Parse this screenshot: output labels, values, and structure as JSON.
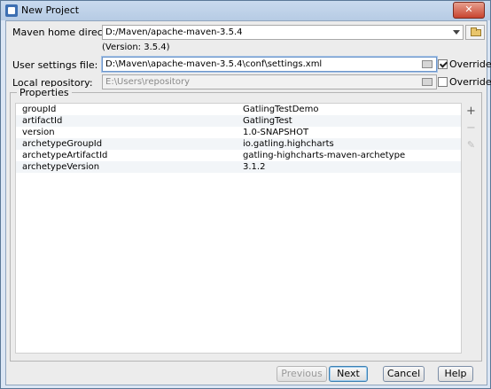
{
  "window": {
    "title": "New Project",
    "close_glyph": "✕"
  },
  "maven_home": {
    "label": "Maven home directory:",
    "value": "D:/Maven/apache-maven-3.5.4",
    "version_text": "(Version: 3.5.4)"
  },
  "user_settings": {
    "label": "User settings file:",
    "value": "D:\\Maven\\apache-maven-3.5.4\\conf\\settings.xml",
    "override_label": "Override",
    "override_checked": true
  },
  "local_repo": {
    "label": "Local repository:",
    "value": "E:\\Users\\repository",
    "override_label": "Override",
    "override_checked": false
  },
  "properties": {
    "title": "Properties",
    "rows": [
      {
        "key": "groupId",
        "value": "GatlingTestDemo"
      },
      {
        "key": "artifactId",
        "value": "GatlingTest"
      },
      {
        "key": "version",
        "value": "1.0-SNAPSHOT"
      },
      {
        "key": "archetypeGroupId",
        "value": "io.gatling.highcharts"
      },
      {
        "key": "archetypeArtifactId",
        "value": "gatling-highcharts-maven-archetype"
      },
      {
        "key": "archetypeVersion",
        "value": "3.1.2"
      }
    ],
    "tools": {
      "add": "+",
      "remove": "−",
      "edit": "✎"
    }
  },
  "buttons": {
    "previous": "Previous",
    "next": "Next",
    "cancel": "Cancel",
    "help": "Help"
  }
}
